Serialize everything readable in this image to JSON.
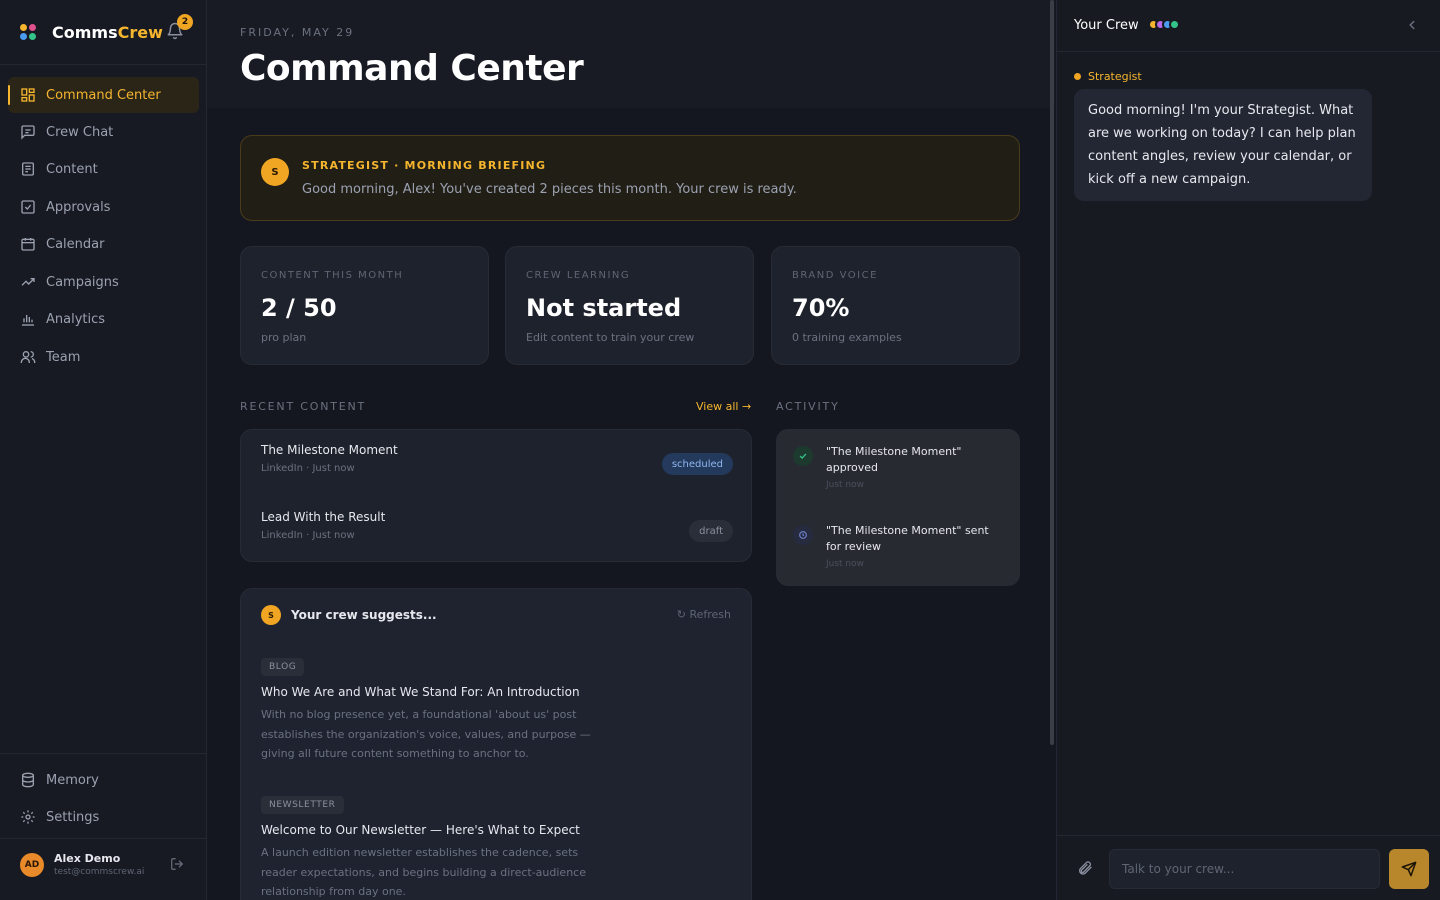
{
  "brand": {
    "name_prefix": "Comms",
    "name_suffix": "Crew",
    "notification_count": "2"
  },
  "sidebar": {
    "items": [
      {
        "label": "Command Center",
        "icon": "dashboard-icon"
      },
      {
        "label": "Crew Chat",
        "icon": "chat-icon"
      },
      {
        "label": "Content",
        "icon": "document-icon"
      },
      {
        "label": "Approvals",
        "icon": "checkbox-icon"
      },
      {
        "label": "Calendar",
        "icon": "calendar-icon"
      },
      {
        "label": "Campaigns",
        "icon": "trend-icon"
      },
      {
        "label": "Analytics",
        "icon": "bar-chart-icon"
      },
      {
        "label": "Team",
        "icon": "users-icon"
      }
    ],
    "bottom_items": [
      {
        "label": "Memory",
        "icon": "database-icon"
      },
      {
        "label": "Settings",
        "icon": "gear-icon"
      }
    ],
    "user": {
      "initials": "AD",
      "name": "Alex Demo",
      "email": "test@commscrew.ai"
    }
  },
  "header": {
    "date": "FRIDAY, MAY 29",
    "title": "Command Center"
  },
  "briefing": {
    "badge": "S",
    "label": "STRATEGIST · MORNING BRIEFING",
    "text": "Good morning, Alex! You've created 2 pieces this month. Your crew is ready."
  },
  "stats": [
    {
      "label": "CONTENT THIS MONTH",
      "value": "2 / 50",
      "sub": "pro plan"
    },
    {
      "label": "CREW LEARNING",
      "value": "Not started",
      "sub": "Edit content to train your crew"
    },
    {
      "label": "BRAND VOICE",
      "value": "70%",
      "sub": "0 training examples"
    }
  ],
  "recent": {
    "label": "RECENT CONTENT",
    "view_all": "View all →",
    "items": [
      {
        "title": "The Milestone Moment",
        "meta": "LinkedIn · Just now",
        "status": "scheduled"
      },
      {
        "title": "Lead With the Result",
        "meta": "LinkedIn · Just now",
        "status": "draft"
      }
    ]
  },
  "activity": {
    "label": "ACTIVITY",
    "items": [
      {
        "text": "\"The Milestone Moment\" approved",
        "time": "Just now",
        "icon": "check-icon"
      },
      {
        "text": "\"The Milestone Moment\" sent for review",
        "time": "Just now",
        "icon": "clock-icon"
      }
    ]
  },
  "suggestions": {
    "badge": "S",
    "title": "Your crew suggests...",
    "refresh": "Refresh",
    "items": [
      {
        "tag": "BLOG",
        "title": "Who We Are and What We Stand For: An Introduction",
        "description": "With no blog presence yet, a foundational 'about us' post establishes the organization's voice, values, and purpose — giving all future content something to anchor to."
      },
      {
        "tag": "NEWSLETTER",
        "title": "Welcome to Our Newsletter — Here's What to Expect",
        "description": "A launch edition newsletter establishes the cadence, sets reader expectations, and begins building a direct-audience relationship from day one."
      }
    ]
  },
  "panel": {
    "title": "Your Crew",
    "speaker": "Strategist",
    "message": "Good morning! I'm your Strategist. What are we working on today? I can help plan content angles, review your calendar, or kick off a new campaign.",
    "input_placeholder": "Talk to your crew..."
  },
  "colors": {
    "accent": "#f5b52e",
    "background": "#14171f",
    "card": "#1e222c",
    "scheduled": "#8fb7f0",
    "success": "#34c48a"
  }
}
